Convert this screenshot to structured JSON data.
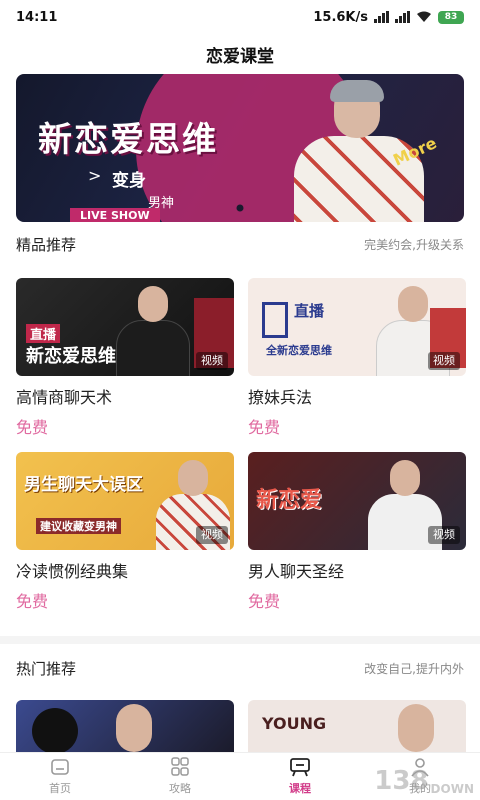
{
  "status": {
    "time": "14:11",
    "speed": "15.6K/s",
    "battery": "83"
  },
  "page_title": "恋爱课堂",
  "banner": {
    "title": "新恋爱思维",
    "subtitle": "变身",
    "subtitle2": "男神",
    "live": "LIVE SHOW",
    "more": "More"
  },
  "featured": {
    "title": "精品推荐",
    "subtitle": "完美约会,升级关系",
    "cards": [
      {
        "name": "高情商聊天术",
        "price": "免费",
        "badge": "视频",
        "caption": "新恋爱思维",
        "caption_small": "直播"
      },
      {
        "name": "撩妹兵法",
        "price": "免费",
        "badge": "视频",
        "caption": "全新恋爱思维",
        "caption_small": "直播"
      },
      {
        "name": "冷读惯例经典集",
        "price": "免费",
        "badge": "视频",
        "caption": "男生聊天大误区",
        "caption_small": "建议收藏变男神"
      },
      {
        "name": "男人聊天圣经",
        "price": "免费",
        "badge": "视频",
        "caption": "新恋爱",
        "caption_small": ""
      }
    ]
  },
  "hot": {
    "title": "热门推荐",
    "subtitle": "改变自己,提升内外"
  },
  "tabs": [
    {
      "label": "首页",
      "icon": "home-icon"
    },
    {
      "label": "攻略",
      "icon": "grid-icon"
    },
    {
      "label": "课程",
      "icon": "course-icon"
    },
    {
      "label": "我的",
      "icon": "profile-icon"
    }
  ],
  "watermark": {
    "number": "138",
    "text": "DOWN"
  },
  "colors": {
    "accent": "#d23d8a",
    "price": "#e06aa0"
  }
}
